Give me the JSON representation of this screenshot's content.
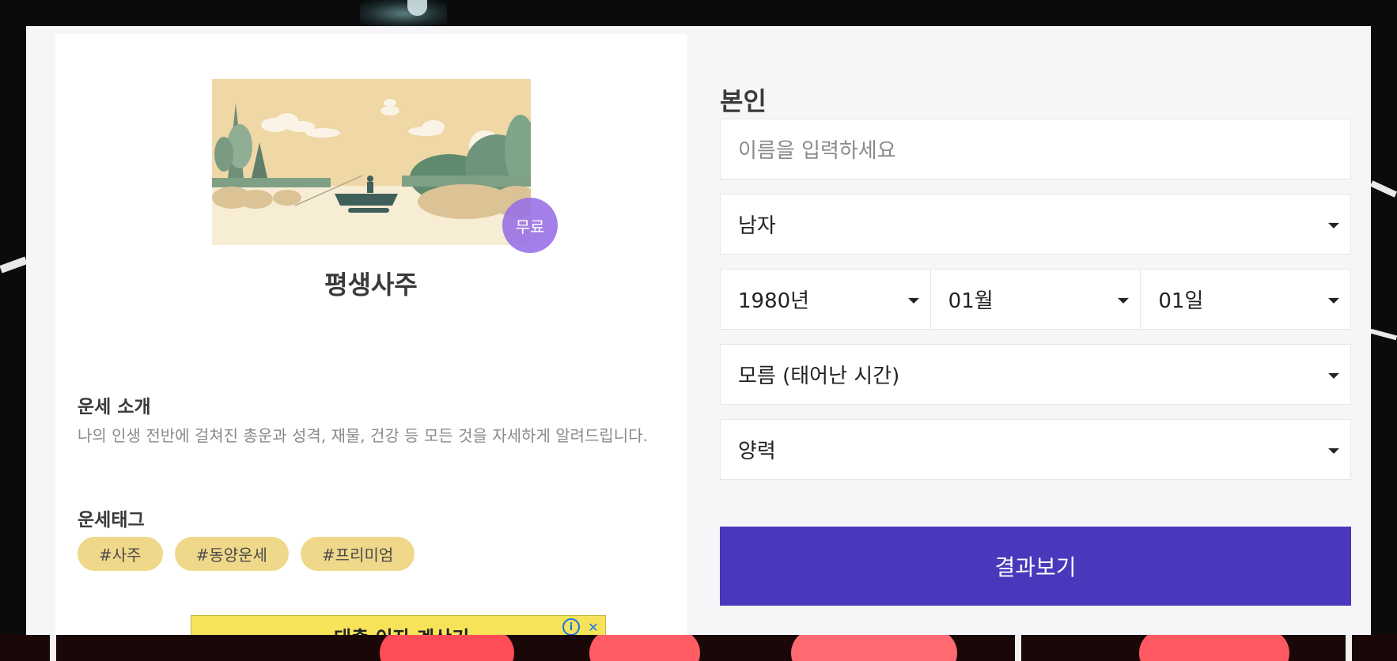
{
  "product": {
    "badge": "무료",
    "title": "평생사주",
    "intro_heading": "운세 소개",
    "intro_text": "나의 인생 전반에 걸쳐진 총운과 성격, 재물, 건강 등 모든 것을 자세하게 알려드립니다.",
    "tags_heading": "운세태그",
    "tags": [
      "#사주",
      "#동양운세",
      "#프리미엄"
    ]
  },
  "ad": {
    "text": "대출 이자 계산기"
  },
  "form": {
    "section_title": "본인",
    "name_placeholder": "이름을 입력하세요",
    "gender": "남자",
    "year": "1980년",
    "month": "01월",
    "day": "01일",
    "birth_time": "모름 (태어난 시간)",
    "calendar": "양력",
    "submit_label": "결과보기"
  },
  "colors": {
    "accent": "#4938bc",
    "tag_bg": "#f0d88a",
    "badge": "#966ee6"
  },
  "icons": [
    "dropdown-arrow-icon",
    "ad-info-icon",
    "ad-close-icon"
  ]
}
